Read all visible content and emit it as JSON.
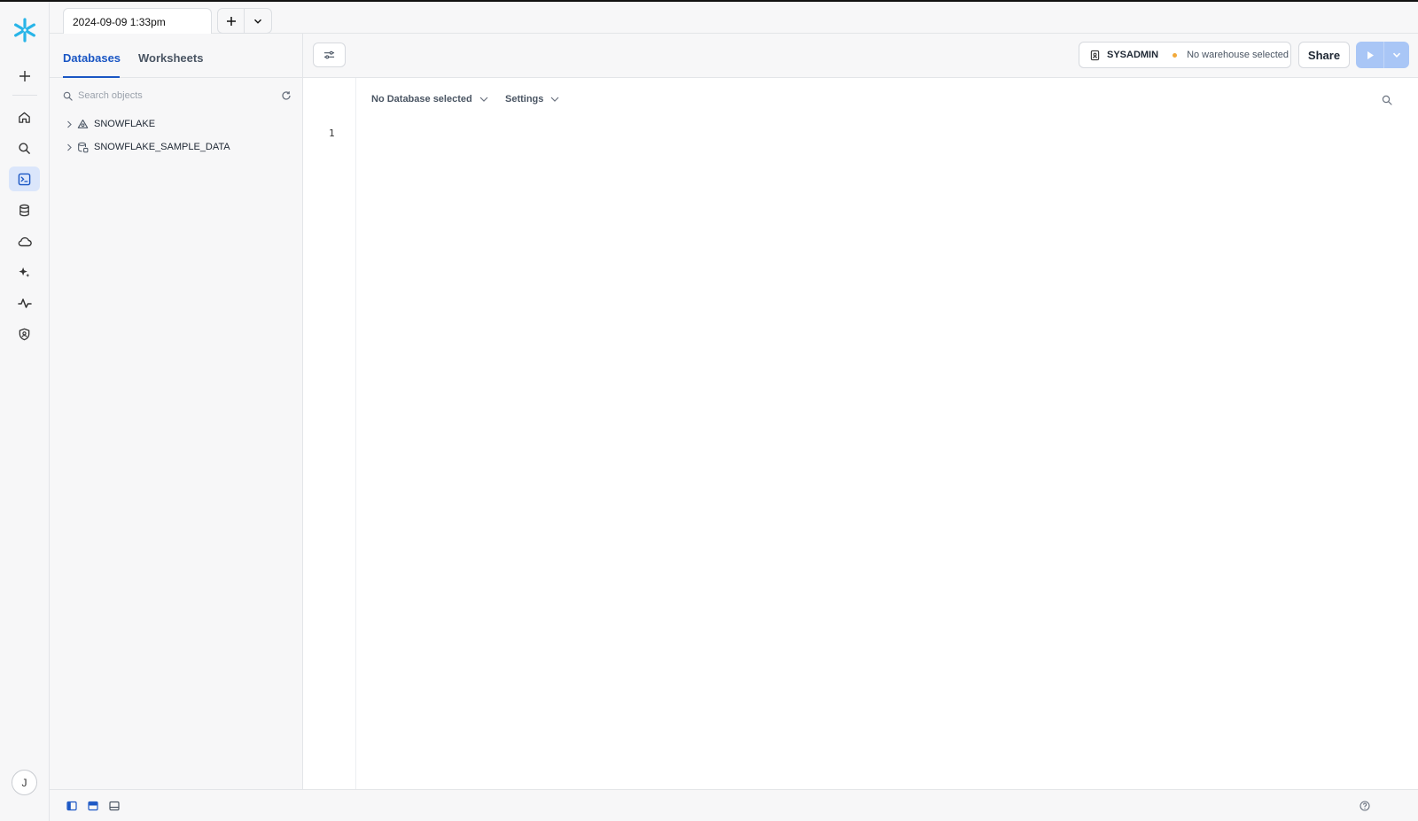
{
  "worksheet_tab": {
    "label": "2024-09-09 1:33pm"
  },
  "rail": {
    "icons": [
      "snowflake-logo",
      "plus-icon",
      "home-icon",
      "search-icon",
      "worksheets-icon",
      "database-icon",
      "cloud-icon",
      "ai-sparkle-icon",
      "activity-icon",
      "admin-shield-icon"
    ],
    "active": "worksheets-icon",
    "avatar_initial": "J"
  },
  "panel": {
    "tabs": [
      {
        "label": "Databases",
        "active": true
      },
      {
        "label": "Worksheets",
        "active": false
      }
    ],
    "search_placeholder": "Search objects",
    "tree": [
      {
        "label": "SNOWFLAKE",
        "icon": "shared-database-icon"
      },
      {
        "label": "SNOWFLAKE_SAMPLE_DATA",
        "icon": "sample-database-icon"
      }
    ]
  },
  "toolbar": {
    "role": "SYSADMIN",
    "warehouse": "No warehouse selected",
    "share_label": "Share"
  },
  "editor": {
    "database_selector": "No Database selected",
    "settings_label": "Settings",
    "line_numbers": [
      "1"
    ]
  },
  "colors": {
    "accent": "#1a56c4",
    "snowflake": "#29b5e8",
    "warning_dot": "#f2a93b",
    "run_button_disabled": "#a9c6f6"
  }
}
